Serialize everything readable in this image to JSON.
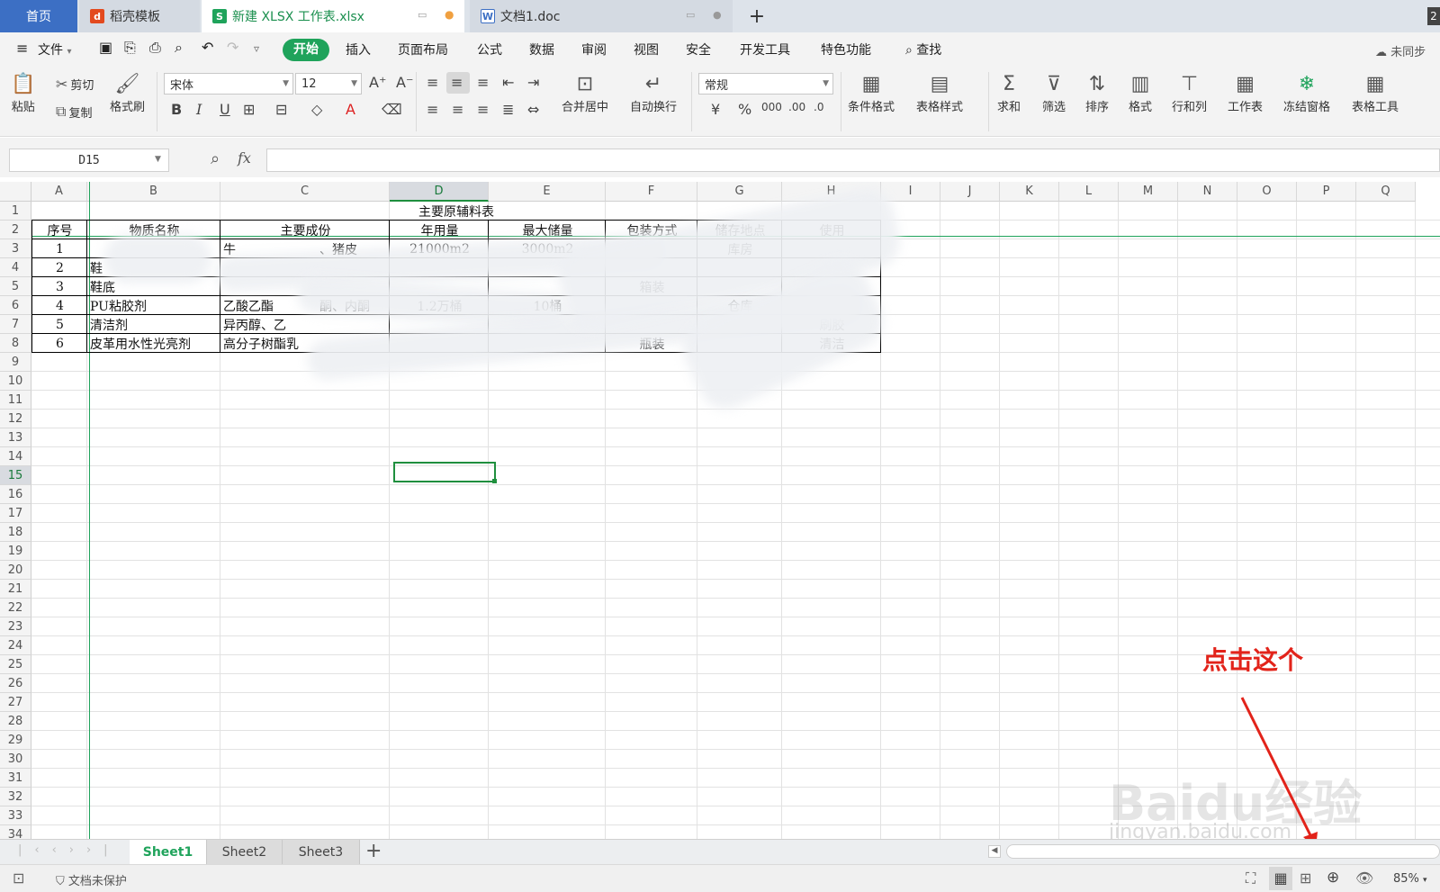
{
  "tabs": {
    "home": "首页",
    "template": "稻壳模板",
    "xlsx": "新建 XLSX 工作表.xlsx",
    "doc": "文档1.doc",
    "new_tab": "+",
    "corner_badge": "2"
  },
  "menubar": {
    "file": "文件",
    "items": [
      "开始",
      "插入",
      "页面布局",
      "公式",
      "数据",
      "审阅",
      "视图",
      "安全",
      "开发工具",
      "特色功能"
    ],
    "search": "查找",
    "sync": "未同步"
  },
  "ribbon": {
    "paste": "粘贴",
    "cut": "剪切",
    "copy": "复制",
    "format_painter": "格式刷",
    "font_name": "宋体",
    "font_size": "12",
    "merge": "合并居中",
    "wrap": "自动换行",
    "number_format": "常规",
    "cond_format": "条件格式",
    "table_style": "表格样式",
    "sum": "求和",
    "filter": "筛选",
    "sort": "排序",
    "format": "格式",
    "rowcol": "行和列",
    "worksheet": "工作表",
    "freeze": "冻结窗格",
    "table_tools": "表格工具"
  },
  "formula": {
    "name_box": "D15",
    "fx": "fx",
    "value": ""
  },
  "columns": [
    "A",
    "B",
    "C",
    "D",
    "E",
    "F",
    "G",
    "H",
    "I",
    "J",
    "K",
    "L",
    "M",
    "N",
    "O",
    "P",
    "Q"
  ],
  "rows": [
    "1",
    "2",
    "3",
    "4",
    "5",
    "6",
    "7",
    "8",
    "9",
    "10",
    "11",
    "12",
    "13",
    "14",
    "15",
    "16",
    "17",
    "18",
    "19",
    "20",
    "21",
    "22",
    "23",
    "24",
    "25",
    "26",
    "27",
    "28",
    "29",
    "30",
    "31",
    "32",
    "33",
    "34"
  ],
  "sheet": {
    "title": "主要原辅料表",
    "headers": [
      "序号",
      "物质名称",
      "主要成份",
      "年用量",
      "最大储量",
      "包装方式",
      "储存地点",
      "使用"
    ],
    "r3": {
      "a": "1",
      "c": "牛",
      "c2": "、猪皮",
      "d": "21000m2",
      "e": "3000m2",
      "g": "库房"
    },
    "r4": {
      "a": "2",
      "b": "鞋"
    },
    "r5": {
      "a": "3",
      "b": "鞋底",
      "f": "箱装"
    },
    "r6": {
      "a": "4",
      "b": "PU粘胶剂",
      "c": "乙酸乙酯",
      "c2": "酮、内酮",
      "d": "1.2万桶",
      "e": "10桶",
      "g": "仓库"
    },
    "r7": {
      "a": "5",
      "b": "清洁剂",
      "c": "异丙醇、乙",
      "h": "刷胶"
    },
    "r8": {
      "a": "6",
      "b": "皮革用水性光亮剂",
      "c": "高分子树酯乳",
      "f": "瓶装",
      "h": "清洁"
    }
  },
  "sheet_tabs": [
    "Sheet1",
    "Sheet2",
    "Sheet3"
  ],
  "status": {
    "protect": "文档未保护",
    "zoom": "85%"
  },
  "annotation": {
    "text": "点击这个",
    "color": "#e2231a"
  },
  "watermark": {
    "brand": "Baidu经验",
    "url": "jingyan.baidu.com"
  }
}
